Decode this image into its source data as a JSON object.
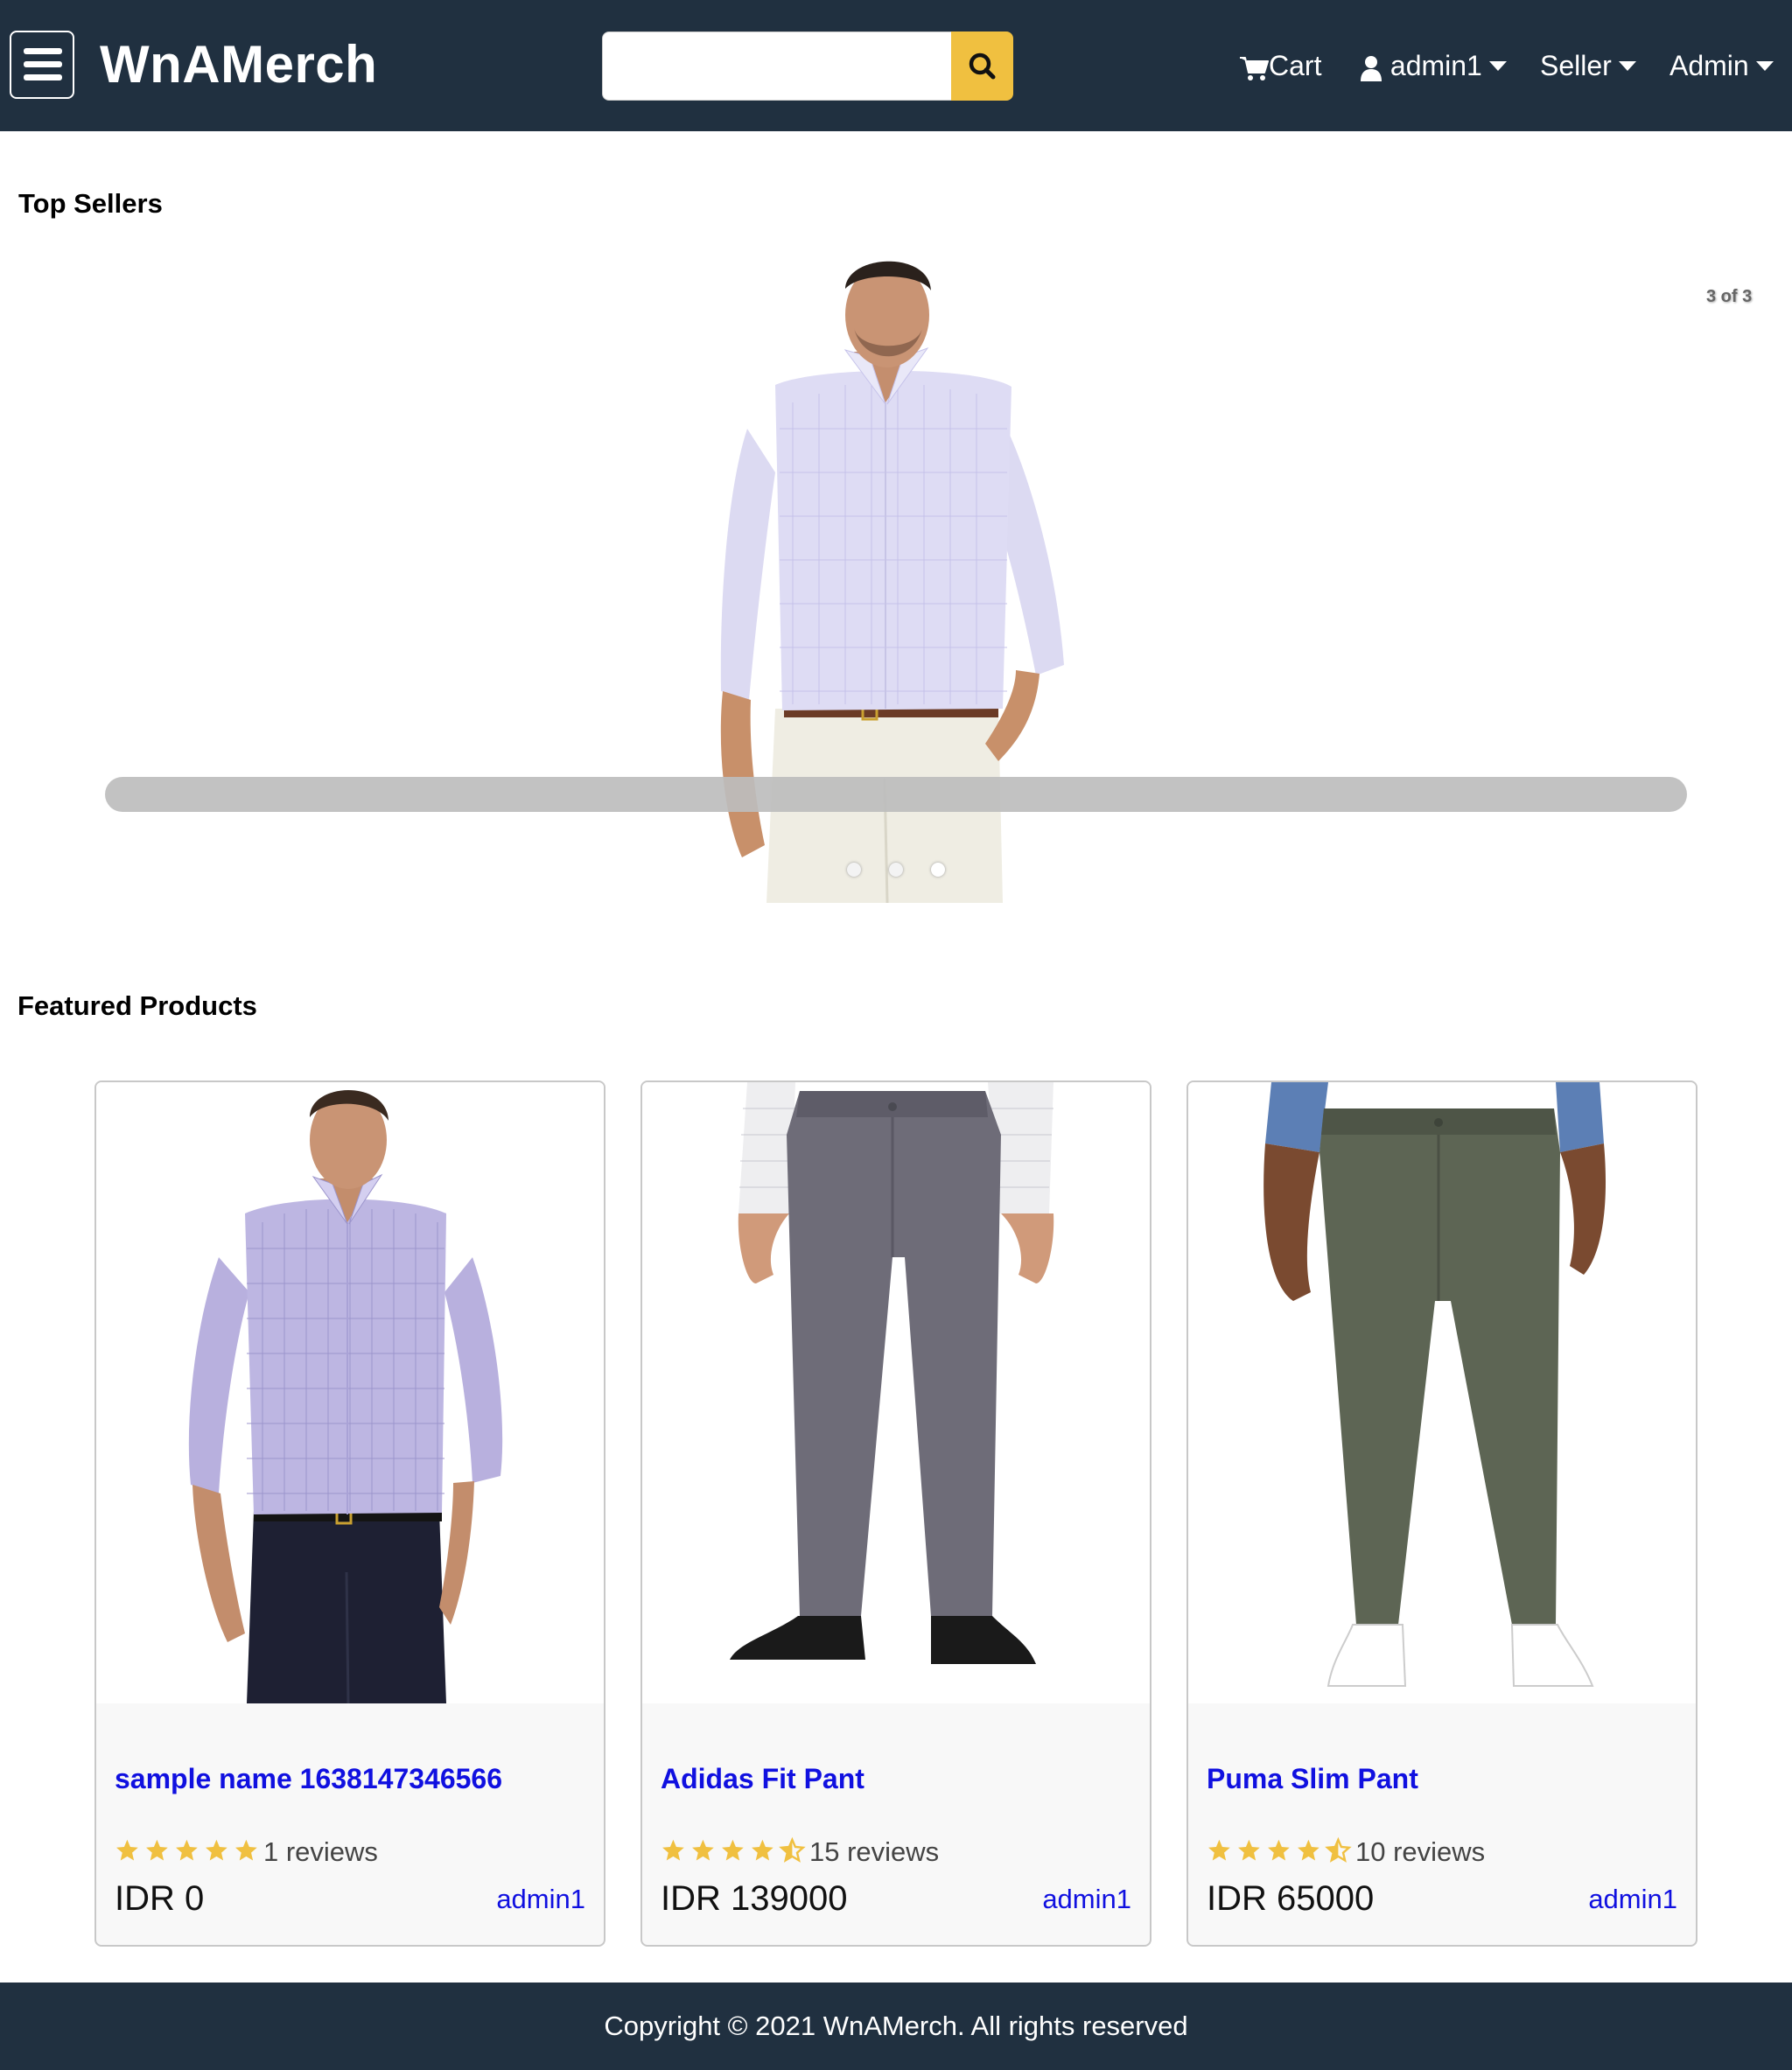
{
  "header": {
    "brand": "WnAMerch",
    "search": {
      "value": "",
      "placeholder": ""
    },
    "nav": {
      "cart": "Cart",
      "user": "admin1",
      "seller": "Seller",
      "admin": "Admin"
    }
  },
  "top_sellers": {
    "title": "Top Sellers",
    "counter": "3 of 3",
    "active_slide": 3,
    "slide_count": 3
  },
  "featured": {
    "title": "Featured Products",
    "products": [
      {
        "name": "sample name 1638147346566",
        "rating": 5,
        "reviews": "1 reviews",
        "price": "IDR 0",
        "seller": "admin1",
        "image": "man-lavender-shirt-navy-pants"
      },
      {
        "name": "Adidas Fit Pant",
        "rating": 4.5,
        "reviews": "15 reviews",
        "price": "IDR 139000",
        "seller": "admin1",
        "image": "grey-pants-black-shoes"
      },
      {
        "name": "Puma Slim Pant",
        "rating": 4.5,
        "reviews": "10 reviews",
        "price": "IDR 65000",
        "seller": "admin1",
        "image": "olive-pants-white-sneakers"
      }
    ]
  },
  "footer": {
    "text": "Copyright © 2021 WnAMerch. All rights reserved"
  },
  "colors": {
    "header_bg": "#203040",
    "search_button": "#f0c040",
    "link": "#1010e0",
    "star": "#f0c040"
  }
}
